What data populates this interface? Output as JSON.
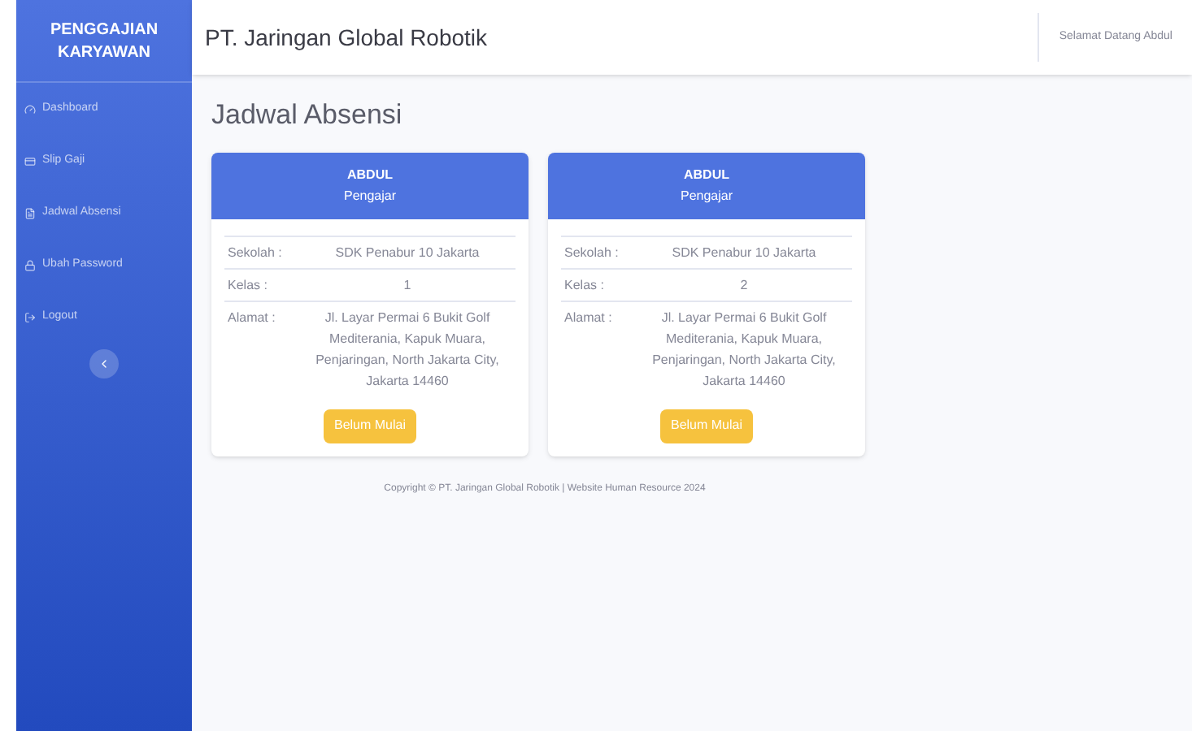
{
  "sidebar": {
    "brand": "PENGGAJIAN KARYAWAN",
    "items": [
      {
        "label": "Dashboard",
        "kind": "dashboard"
      },
      {
        "label": "Slip Gaji",
        "kind": "slip"
      },
      {
        "label": "Jadwal Absensi",
        "kind": "schedule"
      },
      {
        "label": "Ubah Password",
        "kind": "password"
      },
      {
        "label": "Logout",
        "kind": "logout"
      }
    ]
  },
  "header": {
    "title": "PT. Jaringan Global Robotik",
    "greeting": "Selamat Datang Abdul"
  },
  "page_title": "Jadwal Absensi",
  "cards": [
    {
      "name": "ABDUL",
      "role": "Pengajar",
      "rows": [
        {
          "label": "Sekolah :",
          "value": "SDK Penabur 10 Jakarta"
        },
        {
          "label": "Kelas :",
          "value": "1"
        },
        {
          "label": "Alamat :",
          "value": "Jl. Layar Permai 6 Bukit Golf Mediterania, Kapuk Muara, Penjaringan, North Jakarta City, Jakarta 14460"
        }
      ],
      "status": "Belum Mulai"
    },
    {
      "name": "ABDUL",
      "role": "Pengajar",
      "rows": [
        {
          "label": "Sekolah :",
          "value": "SDK Penabur 10 Jakarta"
        },
        {
          "label": "Kelas :",
          "value": "2"
        },
        {
          "label": "Alamat :",
          "value": "Jl. Layar Permai 6 Bukit Golf Mediterania, Kapuk Muara, Penjaringan, North Jakarta City, Jakarta 14460"
        }
      ],
      "status": "Belum Mulai"
    }
  ],
  "footer": "Copyright © PT. Jaringan Global Robotik | Website Human Resource 2024"
}
